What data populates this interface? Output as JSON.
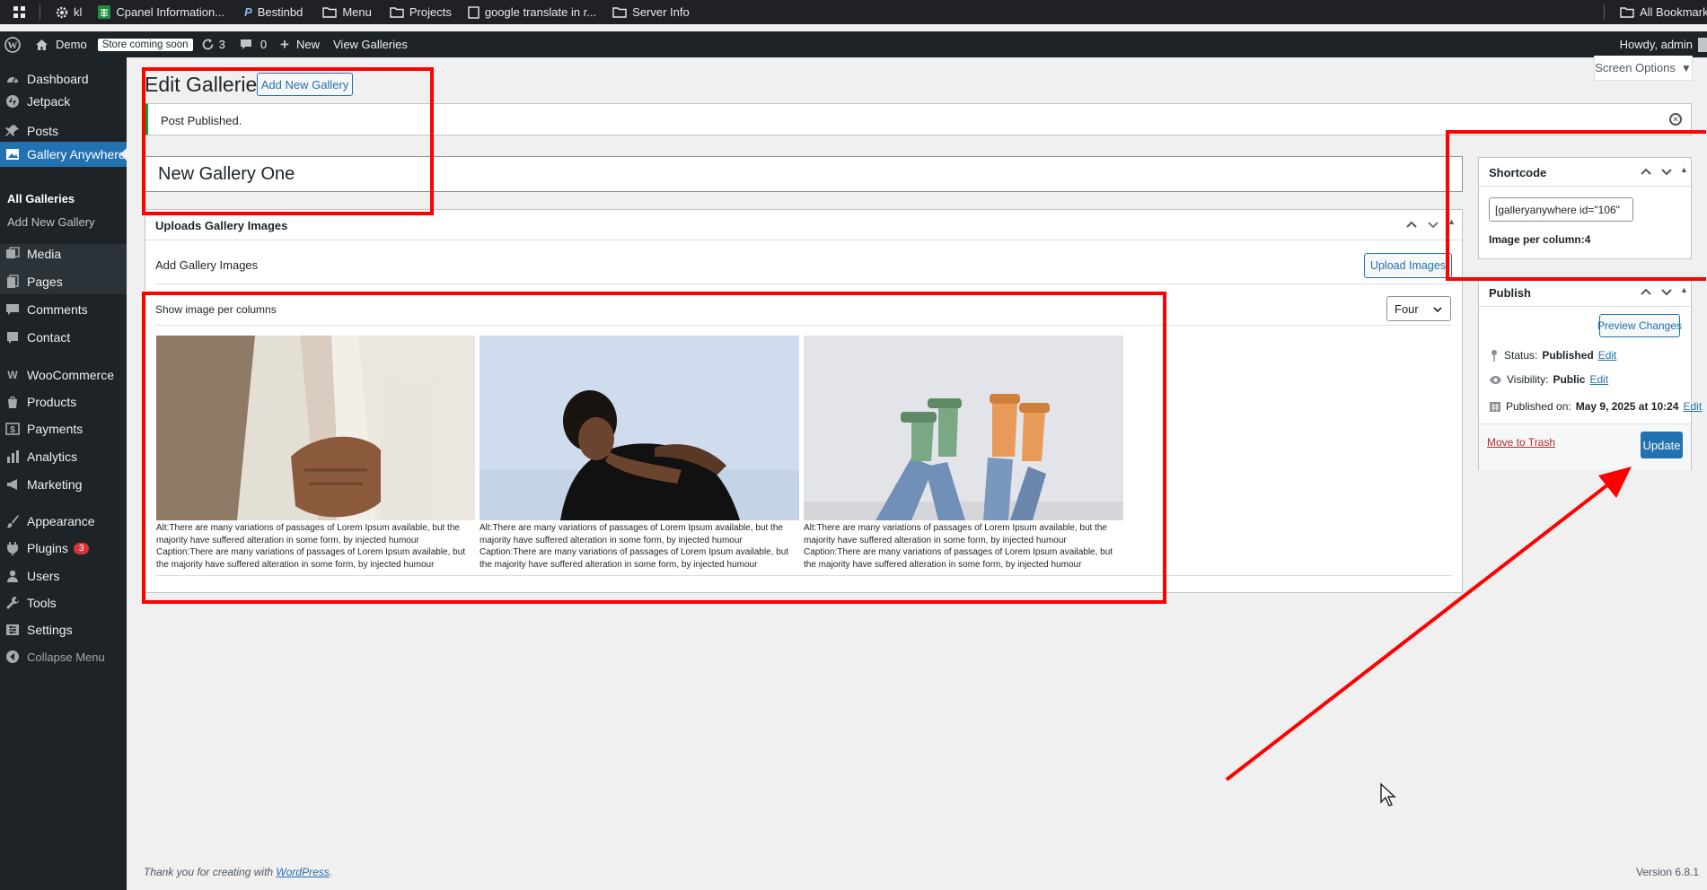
{
  "bookmarks": {
    "items": [
      {
        "label": "kl",
        "icon": "gear-icon"
      },
      {
        "label": "Cpanel Information...",
        "icon": "sheets-icon"
      },
      {
        "label": "Bestinbd",
        "icon": "p-icon"
      },
      {
        "label": "Menu",
        "icon": "folder-icon"
      },
      {
        "label": "Projects",
        "icon": "folder-icon"
      },
      {
        "label": "google translate in r...",
        "icon": "page-icon"
      },
      {
        "label": "Server Info",
        "icon": "folder-icon"
      }
    ],
    "all_bookmarks": "All Bookmarks"
  },
  "adminbar": {
    "site": "Demo",
    "store_badge": "Store coming soon",
    "updates": "3",
    "comments": "0",
    "new": "New",
    "view": "View Galleries",
    "howdy": "Howdy, admin"
  },
  "menu": {
    "dashboard": "Dashboard",
    "jetpack": "Jetpack",
    "posts": "Posts",
    "gallery": "Gallery Anywhere",
    "all_galleries": "All Galleries",
    "add_new_gallery": "Add New Gallery",
    "media": "Media",
    "pages": "Pages",
    "comments": "Comments",
    "contact": "Contact",
    "woocommerce": "WooCommerce",
    "products": "Products",
    "payments": "Payments",
    "analytics": "Analytics",
    "marketing": "Marketing",
    "appearance": "Appearance",
    "plugins": "Plugins",
    "plugins_badge": "3",
    "users": "Users",
    "tools": "Tools",
    "settings": "Settings",
    "collapse": "Collapse Menu"
  },
  "screen_options": "Screen Options",
  "page": {
    "title": "Edit Galleries",
    "add_new": "Add New Gallery",
    "notice": "Post Published.",
    "gallery_title": "New Gallery One"
  },
  "uploads": {
    "title": "Uploads Gallery Images",
    "add_label": "Add Gallery Images",
    "upload_button": "Upload Images",
    "columns_label": "Show image per columns",
    "columns_value": "Four"
  },
  "gallery_items": [
    {
      "alt_label": "Alt:",
      "alt": "There are many variations of passages of Lorem Ipsum available, but the majority have suffered alteration in some form, by injected humour",
      "caption_label": "Caption:",
      "caption": "There are many variations of passages of Lorem Ipsum available, but the majority have suffered alteration in some form, by injected humour"
    },
    {
      "alt_label": "Alt:",
      "alt": "There are many variations of passages of Lorem Ipsum available, but the majority have suffered alteration in some form, by injected humour",
      "caption_label": "Caption:",
      "caption": "There are many variations of passages of Lorem Ipsum available, but the majority have suffered alteration in some form, by injected humour"
    },
    {
      "alt_label": "Alt:",
      "alt": "There are many variations of passages of Lorem Ipsum available, but the majority have suffered alteration in some form, by injected humour",
      "caption_label": "Caption:",
      "caption": "There are many variations of passages of Lorem Ipsum available, but the majority have suffered alteration in some form, by injected humour"
    }
  ],
  "shortcode": {
    "title": "Shortcode",
    "value": "[galleryanywhere id=\"106\"",
    "per_column_label": "Image per column:",
    "per_column_value": "4"
  },
  "publish": {
    "title": "Publish",
    "preview": "Preview Changes",
    "status_label": "Status:",
    "status": "Published",
    "visibility_label": "Visibility:",
    "visibility": "Public",
    "published_label": "Published on:",
    "published": "May 9, 2025 at 10:24",
    "edit": "Edit",
    "trash": "Move to Trash",
    "update": "Update"
  },
  "footer": {
    "thanks_prefix": "Thank you for creating with ",
    "wordpress": "WordPress",
    "thanks_suffix": ".",
    "version": "Version 6.8.1"
  },
  "colors": {
    "admin_blue": "#2271b1",
    "annotation_red": "#ff0000",
    "menu_bg": "#1d2327"
  }
}
